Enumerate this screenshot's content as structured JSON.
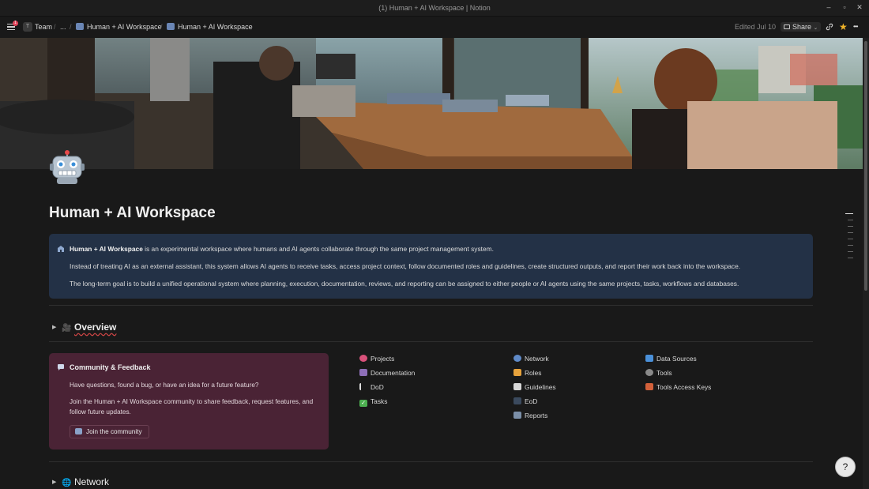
{
  "window": {
    "title": "(1) Human + AI Workspace | Notion",
    "minimize": "–",
    "maximize": "▫",
    "close": "✕"
  },
  "topbar": {
    "notification_count": "1",
    "team_initial": "T",
    "team_label": "Team",
    "ellipsis": "...",
    "crumb1": "Human + AI Workspace",
    "crumb2": "Human + AI Workspace",
    "edited": "Edited Jul 10",
    "share": "Share",
    "share_chevron": "⌄",
    "more": "•••"
  },
  "page": {
    "title": "Human + AI Workspace",
    "intro": {
      "bold": "Human + AI Workspace",
      "line1_rest": " is an experimental workspace where humans and AI agents collaborate through the same project management system.",
      "line2": "Instead of treating AI as an external assistant, this system allows AI agents to receive tasks, access project context, follow documented roles and guidelines, create structured outputs, and report their work back into the workspace.",
      "line3": "The long-term goal is to build a unified operational system where planning, execution, documentation, reviews, and reporting can be assigned to either people or AI agents using the same projects, tasks, workflows and databases."
    },
    "overview": {
      "heading": "Overview"
    },
    "community": {
      "heading": "Community & Feedback",
      "line1": "Have questions, found a bug, or have an idea for a future feature?",
      "line2": "Join the Human + AI Workspace community to share feedback, request features, and follow future updates.",
      "button": "Join the community"
    },
    "links": {
      "col1": [
        "Projects",
        "Documentation",
        "DoD",
        "Tasks"
      ],
      "col2": [
        "Network",
        "Roles",
        "Guidelines",
        "EoD",
        "Reports"
      ],
      "col3": [
        "Data Sources",
        "Tools",
        "Tools Access Keys"
      ]
    },
    "network": {
      "heading": "Network"
    }
  },
  "colors": {
    "callout_blue": "#233146",
    "callout_purple": "#4a2335"
  },
  "help_label": "?"
}
